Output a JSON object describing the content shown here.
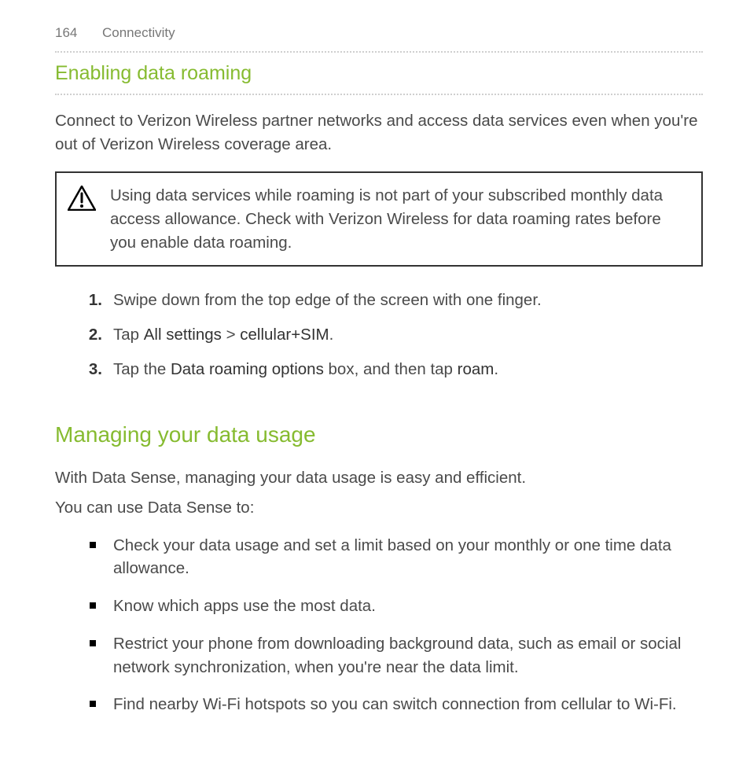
{
  "header": {
    "page_number": "164",
    "chapter": "Connectivity"
  },
  "s1": {
    "title": "Enabling data roaming",
    "intro": "Connect to Verizon Wireless partner networks and access data services even when you're out of Verizon Wireless coverage area.",
    "callout": "Using data services while roaming is not part of your subscribed monthly data access allowance. Check with Verizon Wireless for data roaming rates before you enable data roaming.",
    "step1": "Swipe down from the top edge of the screen with one finger.",
    "step2_a": "Tap ",
    "step2_b": "All settings",
    "step2_c": " > ",
    "step2_d": "cellular+SIM",
    "step2_e": ".",
    "step3_a": "Tap the ",
    "step3_b": "Data roaming options",
    "step3_c": " box, and then tap ",
    "step3_d": "roam",
    "step3_e": "."
  },
  "s2": {
    "title": "Managing your data usage",
    "p1": "With Data Sense, managing your data usage is easy and efficient.",
    "p2": "You can use Data Sense to:",
    "b1": "Check your data usage and set a limit based on your monthly or one time data allowance.",
    "b2": "Know which apps use the most data.",
    "b3": "Restrict your phone from downloading background data, such as email or social network synchronization, when you're near the data limit.",
    "b4": "Find nearby Wi-Fi hotspots so you can switch connection from cellular to Wi-Fi."
  }
}
